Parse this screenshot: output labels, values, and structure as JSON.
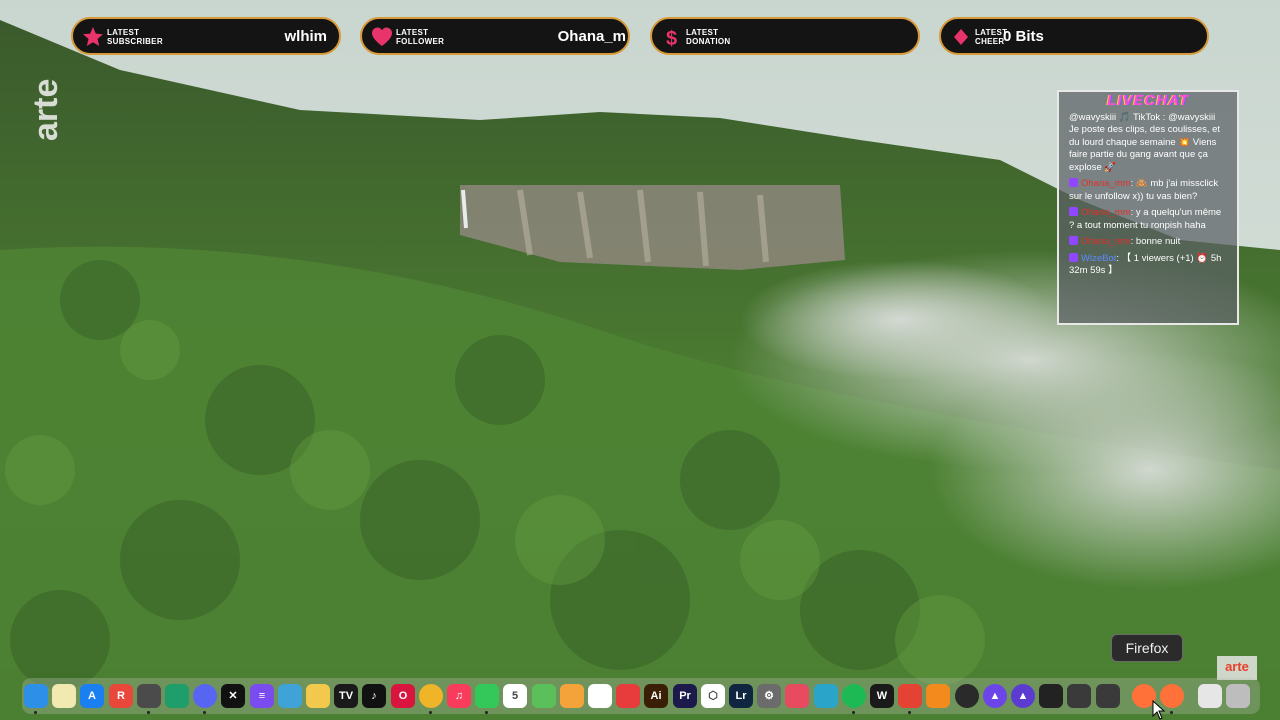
{
  "alerts": [
    {
      "label_line1": "LATEST",
      "label_line2": "SUBSCRIBER",
      "value": "wlhim",
      "icon": "star-icon",
      "color": "#e8336b"
    },
    {
      "label_line1": "LATEST",
      "label_line2": "FOLLOWER",
      "value": "Ohana_m",
      "icon": "heart-icon",
      "color": "#e8336b"
    },
    {
      "label_line1": "LATEST",
      "label_line2": "DONATION",
      "value": "",
      "icon": "dollar-icon",
      "color": "#e8336b"
    },
    {
      "label_line1": "LATEST",
      "label_line2": "CHEER",
      "value": "0 Bits",
      "icon": "diamond-icon",
      "color": "#e8336b"
    }
  ],
  "watermark": {
    "side": "arte",
    "corner": "arte"
  },
  "livechat": {
    "title": "LIVECHAT",
    "messages": [
      {
        "user": "",
        "text": "@wavyskiii 🎵 TikTok : @wavyskiii Je poste des clips, des coulisses, et du lourd chaque semaine 💥 Viens faire partie du gang avant que ça explose 🚀"
      },
      {
        "user": "Ohana_mm",
        "text": ": 🙈 mb j'ai missclick sur le unfollow x)) tu vas bien?"
      },
      {
        "user": "Ohana_mm",
        "text": ": y a quelqu'un même ? a tout moment tu ronpish haha"
      },
      {
        "user": "Ohana_mm",
        "text": ": bonne nuit"
      },
      {
        "user": "WizeBot",
        "text": ": 【 1 viewers (+1) ⏰ 5h 32m 59s 】"
      }
    ]
  },
  "dock": {
    "tooltip": "Firefox",
    "apps": [
      {
        "name": "finder-icon",
        "glyph": "",
        "color": "#2e8fe8"
      },
      {
        "name": "notes-icon",
        "glyph": "",
        "color": "#f2e9b0"
      },
      {
        "name": "app-store-icon",
        "glyph": "A",
        "color": "#1a7ff0"
      },
      {
        "name": "reeder-icon",
        "glyph": "R",
        "color": "#e8473a"
      },
      {
        "name": "activity-icon",
        "glyph": "",
        "color": "#4b4b4b"
      },
      {
        "name": "terminal-app-icon",
        "glyph": "",
        "color": "#1f9d6a"
      },
      {
        "name": "discord-icon",
        "glyph": "",
        "color": "#5865f2"
      },
      {
        "name": "capcut-icon",
        "glyph": "✕",
        "color": "#111111"
      },
      {
        "name": "lines-icon",
        "glyph": "≡",
        "color": "#7a4cf0"
      },
      {
        "name": "preview-icon",
        "glyph": "",
        "color": "#3fa3d8"
      },
      {
        "name": "money-icon",
        "glyph": "",
        "color": "#f2c94c"
      },
      {
        "name": "tradingview-icon",
        "glyph": "TV",
        "color": "#1a1a1a"
      },
      {
        "name": "tiktok-icon",
        "glyph": "♪",
        "color": "#111111"
      },
      {
        "name": "opera-icon",
        "glyph": "O",
        "color": "#d9143f"
      },
      {
        "name": "chrome-icon",
        "glyph": "",
        "color": "#f0b429"
      },
      {
        "name": "music-icon",
        "glyph": "♫",
        "color": "#fa3c5c"
      },
      {
        "name": "messages-icon",
        "glyph": "",
        "color": "#34c759"
      },
      {
        "name": "calendar-icon",
        "glyph": "5",
        "color": "#ffffff"
      },
      {
        "name": "maps-icon",
        "glyph": "",
        "color": "#5bbf5a"
      },
      {
        "name": "photos-icon",
        "glyph": "",
        "color": "#f3a33a"
      },
      {
        "name": "reminders-icon",
        "glyph": "",
        "color": "#ffffff"
      },
      {
        "name": "news-icon",
        "glyph": "",
        "color": "#e83b3b"
      },
      {
        "name": "illustrator-icon",
        "glyph": "Ai",
        "color": "#3a1e05"
      },
      {
        "name": "premiere-icon",
        "glyph": "Pr",
        "color": "#1c1a4d"
      },
      {
        "name": "unity-icon",
        "glyph": "⬡",
        "color": "#ffffff"
      },
      {
        "name": "lightroom-icon",
        "glyph": "Lr",
        "color": "#0f2540"
      },
      {
        "name": "system-prefs-icon",
        "glyph": "⚙",
        "color": "#6b6b6b"
      },
      {
        "name": "toggl-icon",
        "glyph": "",
        "color": "#e84a5f"
      },
      {
        "name": "proxyman-icon",
        "glyph": "",
        "color": "#2aa5c9"
      },
      {
        "name": "spotify-icon",
        "glyph": "",
        "color": "#1db954"
      },
      {
        "name": "waves-icon",
        "glyph": "W",
        "color": "#1a1a1a"
      },
      {
        "name": "todoist-icon",
        "glyph": "",
        "color": "#e44232"
      },
      {
        "name": "fl-studio-icon",
        "glyph": "",
        "color": "#f28a1e"
      },
      {
        "name": "obs-icon",
        "glyph": "",
        "color": "#2a2a2a"
      },
      {
        "name": "arc-icon",
        "glyph": "▲",
        "color": "#6b45e8"
      },
      {
        "name": "aftershock-icon",
        "glyph": "▲",
        "color": "#5b3bd0"
      },
      {
        "name": "monitor-icon",
        "glyph": "",
        "color": "#222222"
      },
      {
        "name": "gauge-icon",
        "glyph": "",
        "color": "#3a3a3a"
      },
      {
        "name": "utility-icon",
        "glyph": "",
        "color": "#3a3a3a"
      },
      {
        "name": "firefox-icon",
        "glyph": "",
        "color": "#ff7139"
      },
      {
        "name": "firefox-dev-icon",
        "glyph": "",
        "color": "#ff7139"
      },
      {
        "name": "downloads-icon",
        "glyph": "",
        "color": "#e6e6e6"
      },
      {
        "name": "trash-icon",
        "glyph": "",
        "color": "#bdbdbd"
      }
    ]
  }
}
